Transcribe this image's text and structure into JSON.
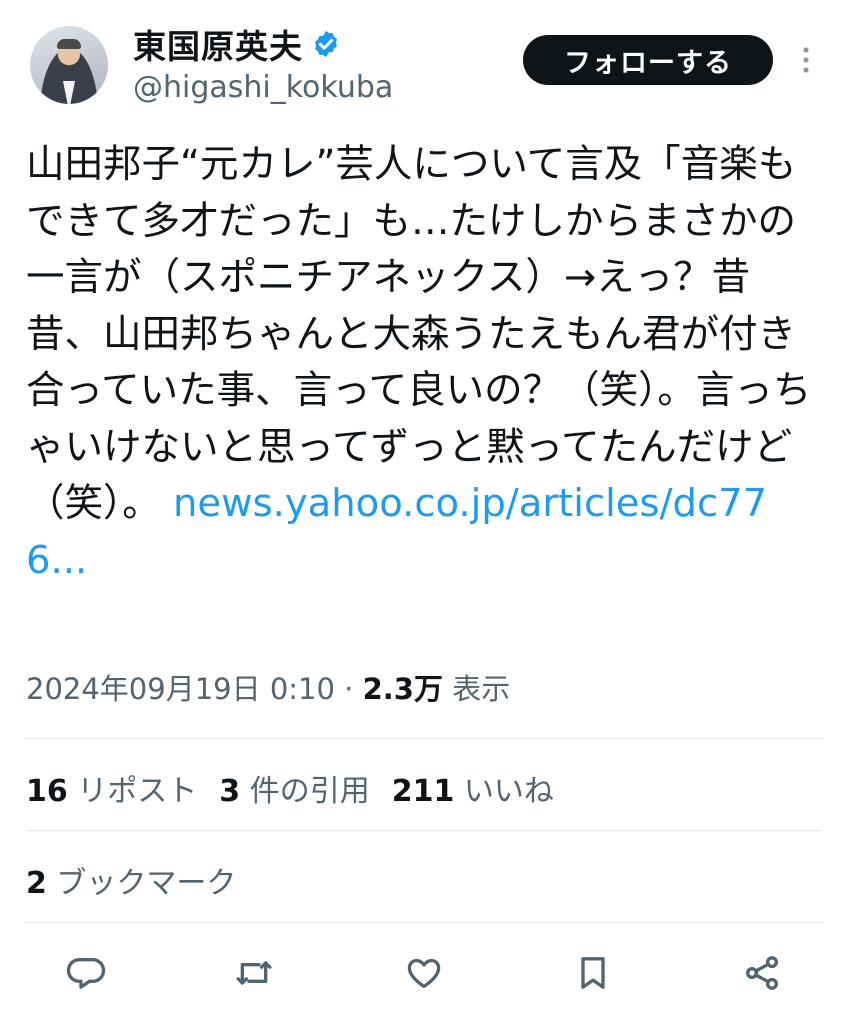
{
  "author": {
    "display_name": "東国原英夫",
    "handle": "@higashi_kokuba",
    "verified": true
  },
  "follow_button": {
    "label": "フォローする"
  },
  "tweet": {
    "text": "山田邦子“元カレ”芸人について言及「音楽もできて多才だった」も…たけしからまさかの一言が（スポニチアネックス）→えっ？昔昔、山田邦ちゃんと大森うたえもん君が付き合っていた事、言って良いの？（笑）。言っちゃいけないと思ってずっと黙ってたんだけど（笑）。",
    "link_text": "news.yahoo.co.jp/articles/dc776..."
  },
  "meta": {
    "timestamp": "2024年09月19日 0:10",
    "separator": "·",
    "views_count": "2.3万",
    "views_label": "表示"
  },
  "stats": {
    "reposts_count": "16",
    "reposts_label": "リポスト",
    "quotes_count": "3",
    "quotes_label": "件の引用",
    "likes_count": "211",
    "likes_label": "いいね",
    "bookmarks_count": "2",
    "bookmarks_label": "ブックマーク"
  },
  "actions": {
    "reply": "reply-icon",
    "repost": "repost-icon",
    "like": "heart-icon",
    "bookmark": "bookmark-icon",
    "share": "share-icon"
  },
  "colors": {
    "link": "#1d9bf0",
    "verified": "#1d9bf0",
    "secondary_text": "#536471",
    "primary_text": "#0f1419"
  }
}
